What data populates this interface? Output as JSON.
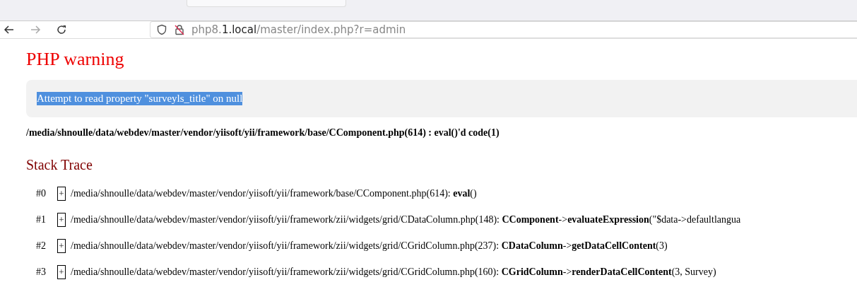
{
  "toolbar": {
    "back": {
      "disabled": false
    },
    "forward": {
      "disabled": true
    },
    "url": {
      "prefix": "php8.",
      "domain": "1.local",
      "path": "/master/index.php?r=admin"
    }
  },
  "error": {
    "title": "PHP warning",
    "message": "Attempt to read property \"surveyls_title\" on null",
    "message_selected": true,
    "location": "/media/shnoulle/data/webdev/master/vendor/yiisoft/yii/framework/base/CComponent.php(614) : eval()'d code(1)"
  },
  "stack_trace": {
    "title": "Stack Trace",
    "frames": [
      {
        "index": "#0",
        "toggle": "+",
        "text": "/media/shnoulle/data/webdev/master/vendor/yiisoft/yii/framework/base/CComponent.php(614): **eval**()"
      },
      {
        "index": "#1",
        "toggle": "+",
        "text": "/media/shnoulle/data/webdev/master/vendor/yiisoft/yii/framework/zii/widgets/grid/CDataColumn.php(148): **CComponent**->**evaluateExpression**(\"$data->defaultlangua"
      },
      {
        "index": "#2",
        "toggle": "+",
        "text": "/media/shnoulle/data/webdev/master/vendor/yiisoft/yii/framework/zii/widgets/grid/CGridColumn.php(237): **CDataColumn**->**getDataCellContent**(3)"
      },
      {
        "index": "#3",
        "toggle": "+",
        "text": "/media/shnoulle/data/webdev/master/vendor/yiisoft/yii/framework/zii/widgets/grid/CGridColumn.php(160): **CGridColumn**->**renderDataCellContent**(3, Survey)"
      }
    ]
  }
}
